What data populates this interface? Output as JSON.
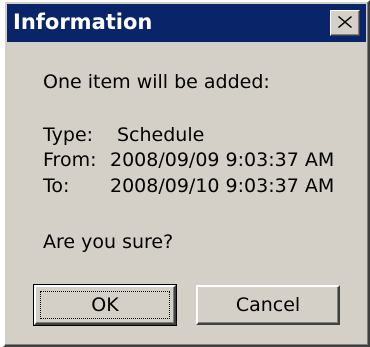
{
  "window": {
    "title": "Information",
    "close_glyph": "close-icon"
  },
  "message": {
    "intro": "One item will be added:",
    "type_label": "Type:",
    "type_value": "Schedule",
    "from_label": "From:",
    "from_value": "2008/09/09 9:03:37 AM",
    "to_label": "To:",
    "to_value": "2008/09/10 9:03:37 AM",
    "question": "Are you sure?"
  },
  "buttons": {
    "ok_label": "OK",
    "cancel_label": "Cancel"
  },
  "colors": {
    "titlebar": "#0a246a",
    "face": "#d4d0c8"
  }
}
